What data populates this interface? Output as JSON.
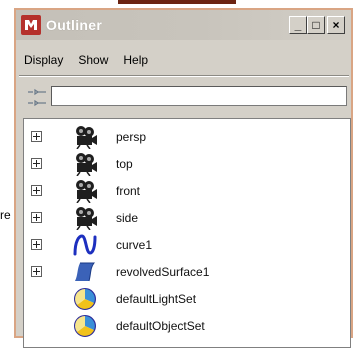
{
  "stray_text": "re",
  "window": {
    "title": "Outliner",
    "controls": [
      {
        "name": "minimize",
        "glyph": "_"
      },
      {
        "name": "maximize",
        "glyph": "□"
      },
      {
        "name": "close",
        "glyph": "×"
      }
    ]
  },
  "menu": [
    "Display",
    "Show",
    "Help"
  ],
  "filter": {
    "value": "",
    "placeholder": ""
  },
  "items": [
    {
      "label": "persp",
      "icon": "camera-icon",
      "expandable": true
    },
    {
      "label": "top",
      "icon": "camera-icon",
      "expandable": true
    },
    {
      "label": "front",
      "icon": "camera-icon",
      "expandable": true
    },
    {
      "label": "side",
      "icon": "camera-icon",
      "expandable": true
    },
    {
      "label": "curve1",
      "icon": "nurbs-curve-icon",
      "expandable": true
    },
    {
      "label": "revolvedSurface1",
      "icon": "nurbs-surface-icon",
      "expandable": true
    },
    {
      "label": "defaultLightSet",
      "icon": "set-icon",
      "expandable": false
    },
    {
      "label": "defaultObjectSet",
      "icon": "set-icon",
      "expandable": false
    }
  ],
  "colors": {
    "titlebar": "#c8c4bc",
    "window_border": "#d9a584",
    "curve": "#1d2fbf",
    "surface": "#3b62b8"
  }
}
